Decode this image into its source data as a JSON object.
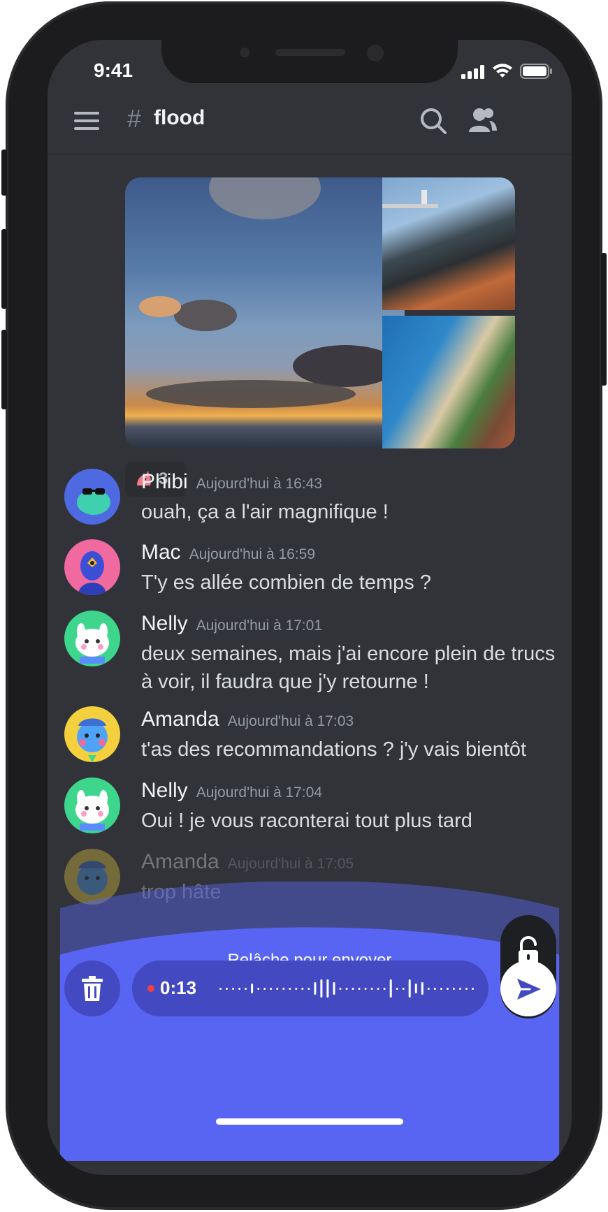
{
  "status": {
    "time": "9:41"
  },
  "header": {
    "hash": "#",
    "channel_name": "flood"
  },
  "reaction": {
    "count": "3"
  },
  "messages": [
    {
      "name": "Phibi",
      "time": "Aujourd'hui à 16:43",
      "text": "ouah, ça a l'air magnifique !",
      "avatar_color": "#4f6ae0"
    },
    {
      "name": "Mac",
      "time": "Aujourd'hui à 16:59",
      "text": "T'y es allée combien de temps ?",
      "avatar_color": "#f06aa0"
    },
    {
      "name": "Nelly",
      "time": "Aujourd'hui à 17:01",
      "text": "deux semaines, mais j'ai encore plein de trucs à voir, il faudra que j'y retourne !",
      "avatar_color": "#3dd68c"
    },
    {
      "name": "Amanda",
      "time": "Aujourd'hui à 17:03",
      "text": "t'as des recommandations ? j'y vais bientôt",
      "avatar_color": "#f4d03f"
    },
    {
      "name": "Nelly",
      "time": "Aujourd'hui à 17:04",
      "text": "Oui ! je vous raconterai tout plus tard",
      "avatar_color": "#3dd68c"
    },
    {
      "name": "Amanda",
      "time": "Aujourd'hui à 17:05",
      "text": "trop hâte",
      "avatar_color": "#f4d03f"
    }
  ],
  "recording": {
    "release_label": "Relâche pour envoyer",
    "duration": "0:13"
  },
  "colors": {
    "accent": "#5865f2",
    "background": "#313338",
    "text": "#dbdee1"
  }
}
